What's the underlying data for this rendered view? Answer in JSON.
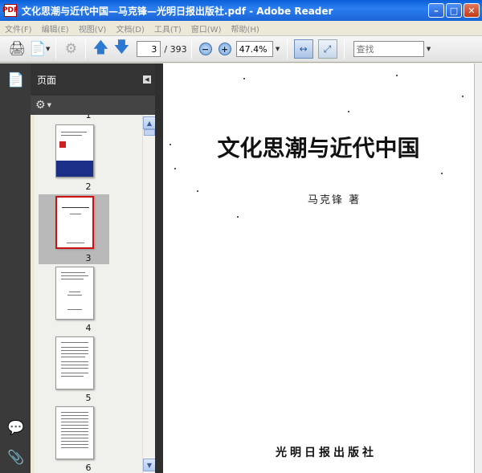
{
  "window": {
    "title": "文化思潮与近代中国—马克锋—光明日报出版社.pdf - Adobe Reader",
    "app_icon": "PDF"
  },
  "menu": [
    "文件(F)",
    "编辑(E)",
    "视图(V)",
    "文档(D)",
    "工具(T)",
    "窗口(W)",
    "帮助(H)"
  ],
  "toolbar": {
    "current_page": "3",
    "total_pages": "/ 393",
    "zoom": "47.4%",
    "search_placeholder": "查找"
  },
  "panel": {
    "title": "页面",
    "thumbnails": [
      {
        "label": "1",
        "selected": false
      },
      {
        "label": "2",
        "selected": false
      },
      {
        "label": "3",
        "selected": true
      },
      {
        "label": "4",
        "selected": false
      },
      {
        "label": "5",
        "selected": false
      },
      {
        "label": "6",
        "selected": false
      }
    ]
  },
  "document": {
    "title": "文化思潮与近代中国",
    "author": "马克锋  著",
    "publisher": "光明日报出版社"
  },
  "colors": {
    "titlebar": "#1a63d6",
    "selected_thumb_border": "#d01010",
    "nav_panel": "#3a3a3a"
  }
}
